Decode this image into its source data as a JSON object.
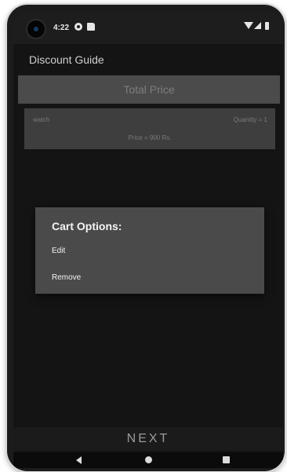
{
  "status_bar": {
    "time": "4:22",
    "icons": [
      "gear-icon",
      "sd-card-icon",
      "wifi-icon",
      "signal-icon",
      "battery-icon"
    ]
  },
  "app": {
    "title": "Discount Guide",
    "total_price_label": "Total Price"
  },
  "cart": {
    "items": [
      {
        "name": "watch",
        "quantity": "Quantity = 1",
        "price": "Price = 900 Rs."
      }
    ]
  },
  "dialog": {
    "title": "Cart Options:",
    "options": [
      "Edit",
      "Remove"
    ]
  },
  "footer": {
    "next_label": "NEXT"
  },
  "nav": {
    "icons": [
      "back-icon",
      "home-icon",
      "recents-icon"
    ]
  },
  "colors": {
    "screen_background": "#141414",
    "dialog_background": "#4a4a4a",
    "card_background": "#3e3e3e"
  }
}
